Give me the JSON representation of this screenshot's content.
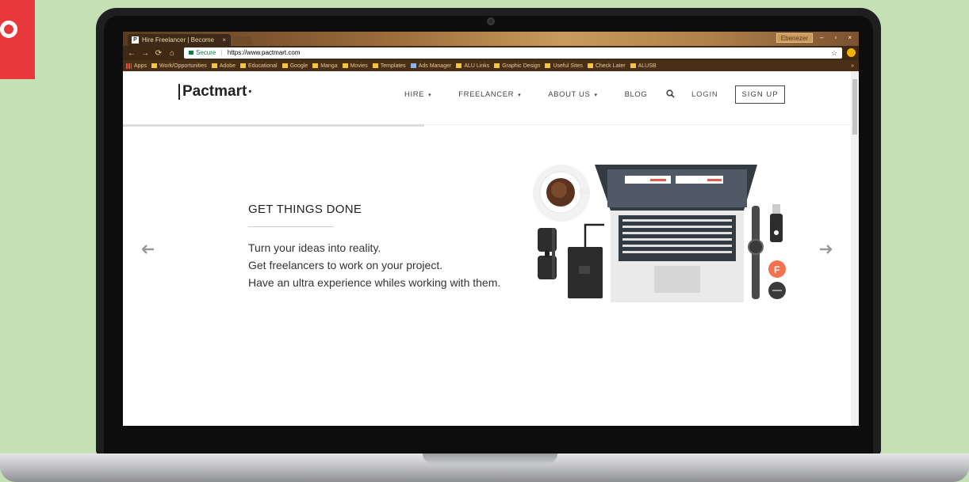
{
  "browser": {
    "tab_title": "Hire Freelancer | Become",
    "tab_favicon": "P",
    "tab_close": "×",
    "window_user": "Ebenezer",
    "window_controls": [
      "–",
      "▫",
      "×"
    ],
    "nav_icons": [
      "←",
      "→",
      "⟳",
      "⌂"
    ],
    "secure_label": "Secure",
    "url": "https://www.pactmart.com",
    "bookmarks": [
      "Apps",
      "Work/Opportunities",
      "Adobe",
      "Educational",
      "Google",
      "Manga",
      "Movies",
      "Templates",
      "Ads Manager",
      "ALU Links",
      "Graphic Design",
      "Useful Sites",
      "Check Later",
      "ALUSB"
    ],
    "bookmarks_overflow": "»"
  },
  "site": {
    "brand": "Pactmart",
    "brand_dot": "•",
    "menu": {
      "hire": "HIRE",
      "freelancer": "FREELANCER",
      "about": "ABOUT US",
      "blog": "BLOG"
    },
    "caret": "▾",
    "login": "LOGIN",
    "signup": "SIGN UP"
  },
  "hero": {
    "headline": "GET THINGS DONE",
    "lines": [
      "Turn your ideas into reality.",
      "Get freelancers to work on your project.",
      "Have an ultra experience whiles working with them."
    ],
    "prev_arrow": "🡐",
    "next_arrow": "🡒",
    "badge_letter": "F"
  },
  "colors": {
    "accent_red": "#e8383b",
    "badge_orange": "#f4714f",
    "background": "#c5e0b4"
  }
}
